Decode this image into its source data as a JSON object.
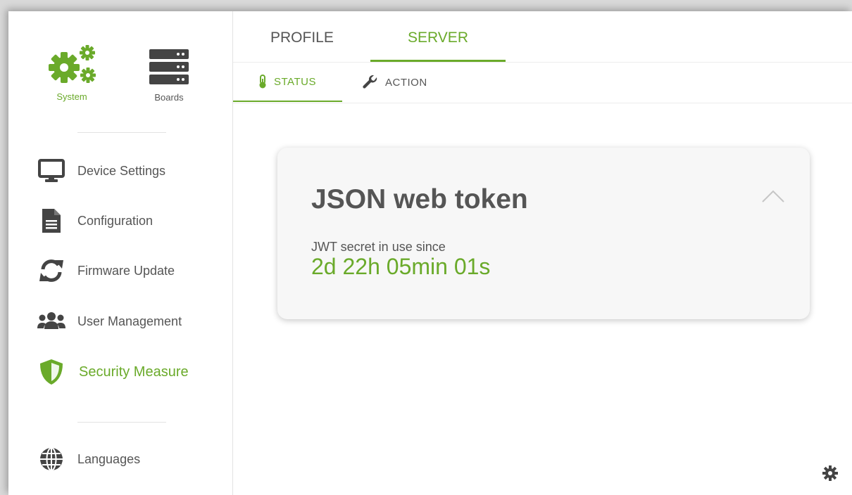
{
  "colors": {
    "accent": "#6aaa2a",
    "text": "#555555",
    "icon": "#444444"
  },
  "sidebar": {
    "top_items": [
      {
        "label": "System",
        "icon": "gears-icon",
        "active": true
      },
      {
        "label": "Boards",
        "icon": "server-rack-icon",
        "active": false
      }
    ],
    "items": [
      {
        "label": "Device Settings",
        "icon": "monitor-icon"
      },
      {
        "label": "Configuration",
        "icon": "document-icon"
      },
      {
        "label": "Firmware Update",
        "icon": "sync-icon"
      },
      {
        "label": "User Management",
        "icon": "users-icon"
      },
      {
        "label": "Security Measure",
        "icon": "shield-icon",
        "active": true
      },
      {
        "label": "Languages",
        "icon": "globe-icon"
      }
    ]
  },
  "tabs": [
    {
      "label": "PROFILE",
      "active": false
    },
    {
      "label": "SERVER",
      "active": true
    }
  ],
  "subtabs": [
    {
      "label": "STATUS",
      "icon": "thermometer-icon",
      "active": true
    },
    {
      "label": "ACTION",
      "icon": "wrench-icon",
      "active": false
    }
  ],
  "card": {
    "title": "JSON web token",
    "label": "JWT secret in use since",
    "value": "2d 22h 05min 01s",
    "collapse_icon": "chevron-up-icon"
  },
  "footer": {
    "settings_icon": "gear-icon"
  }
}
